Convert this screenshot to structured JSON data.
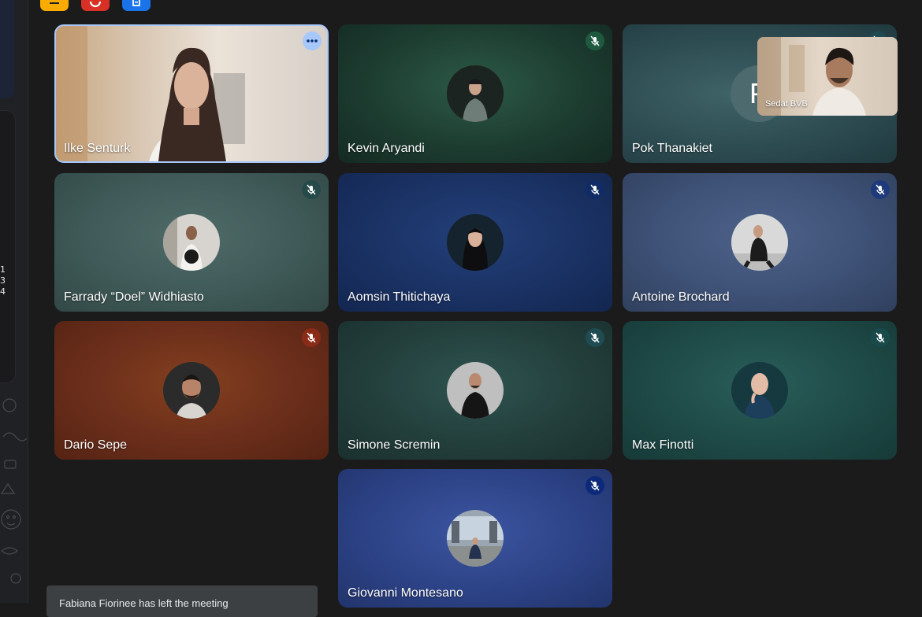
{
  "left_strip": {
    "digits": [
      "1",
      "3",
      "4"
    ]
  },
  "top_toolbar": {
    "icons": [
      {
        "name": "reactions-icon",
        "color": "#f9ab00"
      },
      {
        "name": "record-icon",
        "color": "#d93025"
      },
      {
        "name": "notes-icon",
        "color": "#1a73e8"
      }
    ]
  },
  "participants": [
    {
      "name": "Ilke Senturk",
      "camera_on": true,
      "muted": false,
      "speaking_highlight": true
    },
    {
      "name": "Kevin Aryandi",
      "camera_on": false,
      "muted": true,
      "bg": "#1d3d31"
    },
    {
      "name": "Pok Thanakiet",
      "camera_on": false,
      "muted": true,
      "bg": "#2d4c52",
      "initial": "P"
    },
    {
      "name": "Farrady “Doel” Widhiasto",
      "camera_on": false,
      "muted": true,
      "bg": "#3f5a58"
    },
    {
      "name": "Aomsin Thitichaya",
      "camera_on": false,
      "muted": true,
      "bg": "#1a3264"
    },
    {
      "name": "Antoine Brochard",
      "camera_on": false,
      "muted": true,
      "bg": "#3e5176"
    },
    {
      "name": "Dario Sepe",
      "camera_on": false,
      "muted": true,
      "bg": "#6b2e1b"
    },
    {
      "name": "Simone Scremin",
      "camera_on": false,
      "muted": true,
      "bg": "#233f3c"
    },
    {
      "name": "Max Finotti",
      "camera_on": false,
      "muted": true,
      "bg": "#1e4a47"
    },
    {
      "name": "Giovanni Montesano",
      "camera_on": false,
      "muted": true,
      "bg": "#2d4387"
    }
  ],
  "self_view": {
    "name": "Sedat BVB"
  },
  "toast": {
    "message": "Fabiana Fiorinee has left the meeting"
  }
}
